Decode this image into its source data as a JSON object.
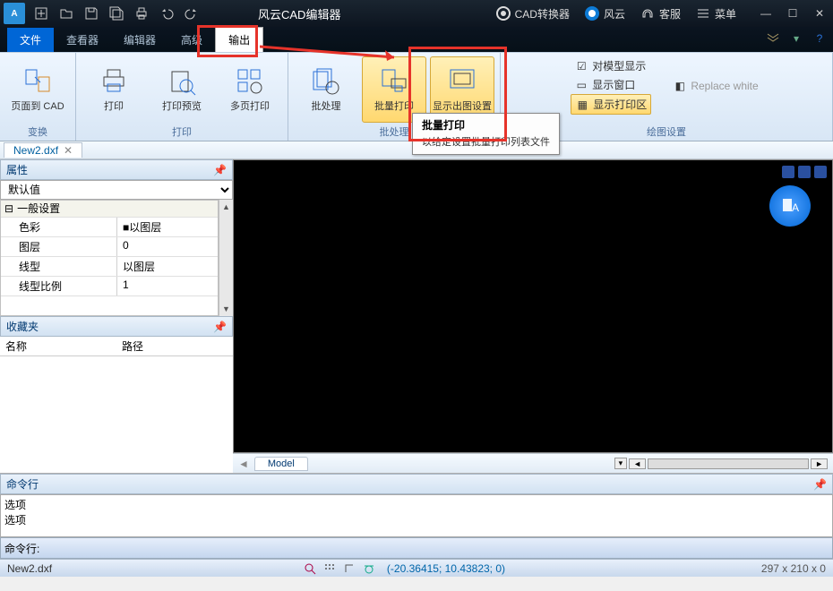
{
  "title": "风云CAD编辑器",
  "top_links": {
    "cad_converter": "CAD转换器",
    "fengyun": "风云",
    "support": "客服",
    "menu": "菜单"
  },
  "ribbon": {
    "tabs": [
      "文件",
      "查看器",
      "编辑器",
      "高级",
      "输出"
    ],
    "active_tab": "文件",
    "output_tab": "输出",
    "groups": {
      "convert": {
        "label": "变换",
        "btn_page_to_cad": "页面到 CAD"
      },
      "print": {
        "label": "打印",
        "btn_print": "打印",
        "btn_preview": "打印预览",
        "btn_multi": "多页打印"
      },
      "batch": {
        "label": "批处理",
        "btn_batch": "批处理",
        "btn_batch_print": "批量打印",
        "btn_plot_settings": "显示出图设置"
      },
      "plot_settings": {
        "label": "绘图设置",
        "chk_model_display": "对模型显示",
        "chk_replace_white": "Replace white",
        "chk_show_window": "显示窗口",
        "chk_show_print_area": "显示打印区"
      }
    }
  },
  "tooltip": {
    "title": "批量打印",
    "body": "以给定设置批量打印列表文件"
  },
  "file_tab": "New2.dxf",
  "panels": {
    "properties": {
      "title": "属性",
      "selector": "默认值",
      "section": "一般设置",
      "rows": [
        {
          "label": "色彩",
          "value": "■以图层"
        },
        {
          "label": "图层",
          "value": "0"
        },
        {
          "label": "线型",
          "value": "以图层"
        },
        {
          "label": "线型比例",
          "value": "1"
        }
      ]
    },
    "favorites": {
      "title": "收藏夹",
      "col_name": "名称",
      "col_path": "路径"
    }
  },
  "model_tab": "Model",
  "command": {
    "title": "命令行",
    "output_lines": [
      "选项",
      "选项"
    ],
    "prompt": "命令行:"
  },
  "status": {
    "file": "New2.dxf",
    "coords": "(-20.36415; 10.43823; 0)",
    "dims": "297 x 210 x 0"
  }
}
